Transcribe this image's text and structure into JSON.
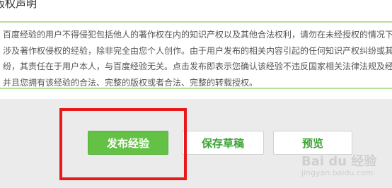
{
  "section": {
    "title": "版权声明"
  },
  "notice": {
    "lines": [
      "百度经验的用户不得侵犯包括他人的著作权在内的知识产权以及其他合法权利，请勿在未经授权的情况下",
      "涉及著作权侵权的经验，除非完全由您个人创作。由于用户发布的相关内容引起的任何知识产权纠纷或其",
      "纷，其责任在于用户本人，与百度经验无关。点击发布即表示您确认该经验不违反国家相关法律法规及经",
      "并且您拥有该经验的合法、完整的版权或者合法、完整的转载授权。"
    ]
  },
  "actions": {
    "publish_label": "发布经验",
    "save_draft_label": "保存草稿",
    "preview_label": "预览"
  },
  "watermark": {
    "brand": "Bai du 经验",
    "sub": "jingyan.baidu.com"
  },
  "colors": {
    "primary_green": "#63c245",
    "secondary_text_green": "#3aa335",
    "notice_border": "#b6df97",
    "highlight_red": "#e61a1a",
    "background_gray": "#ebebeb"
  }
}
